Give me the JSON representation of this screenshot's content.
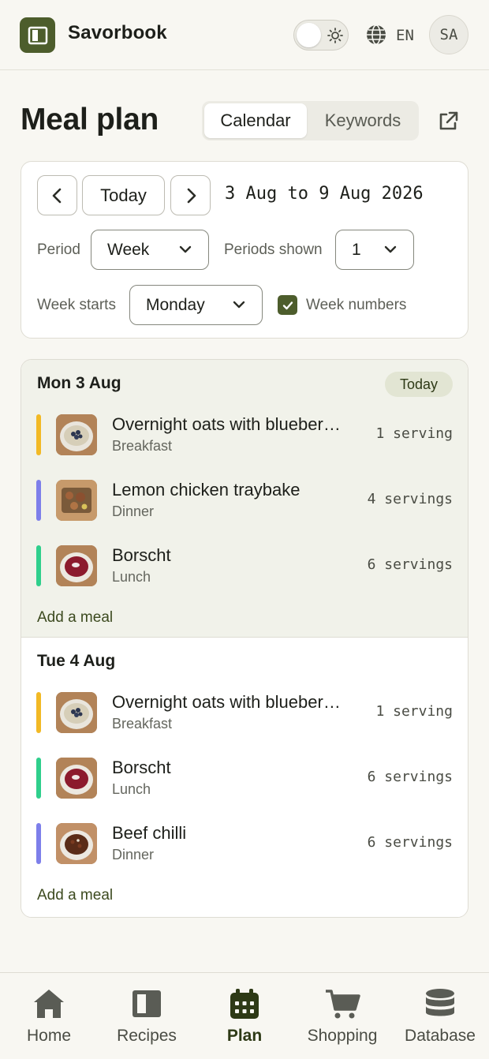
{
  "app": {
    "name": "Savorbook",
    "language": "EN",
    "user_initials": "SA"
  },
  "page": {
    "title": "Meal plan"
  },
  "view_tabs": [
    {
      "label": "Calendar",
      "active": true
    },
    {
      "label": "Keywords",
      "active": false
    }
  ],
  "controls": {
    "today_label": "Today",
    "date_range": "3 Aug to 9 Aug 2026",
    "period_label": "Period",
    "period_value": "Week",
    "periods_shown_label": "Periods shown",
    "periods_shown_value": "1",
    "week_starts_label": "Week starts",
    "week_starts_value": "Monday",
    "week_numbers_label": "Week numbers",
    "week_numbers_checked": true
  },
  "days": [
    {
      "title": "Mon 3 Aug",
      "badge": "Today",
      "meals": [
        {
          "name": "Overnight oats with blueber…",
          "type": "Breakfast",
          "servings": "1 serving",
          "color": "#f2b925"
        },
        {
          "name": "Lemon chicken traybake",
          "type": "Dinner",
          "servings": "4 servings",
          "color": "#7d7fea"
        },
        {
          "name": "Borscht",
          "type": "Lunch",
          "servings": "6 servings",
          "color": "#2fcf8c"
        }
      ],
      "add_label": "Add a meal"
    },
    {
      "title": "Tue 4 Aug",
      "meals": [
        {
          "name": "Overnight oats with blueber…",
          "type": "Breakfast",
          "servings": "1 serving",
          "color": "#f2b925"
        },
        {
          "name": "Borscht",
          "type": "Lunch",
          "servings": "6 servings",
          "color": "#2fcf8c"
        },
        {
          "name": "Beef chilli",
          "type": "Dinner",
          "servings": "6 servings",
          "color": "#7d7fea"
        }
      ],
      "add_label": "Add a meal"
    }
  ],
  "nav": [
    {
      "label": "Home",
      "icon": "home-icon"
    },
    {
      "label": "Recipes",
      "icon": "book-icon"
    },
    {
      "label": "Plan",
      "icon": "calendar-icon",
      "active": true
    },
    {
      "label": "Shopping",
      "icon": "cart-icon"
    },
    {
      "label": "Database",
      "icon": "database-icon"
    }
  ],
  "colors": {
    "brand": "#4d5d2c",
    "breakfast": "#f2b925",
    "dinner": "#7d7fea",
    "lunch": "#2fcf8c"
  }
}
